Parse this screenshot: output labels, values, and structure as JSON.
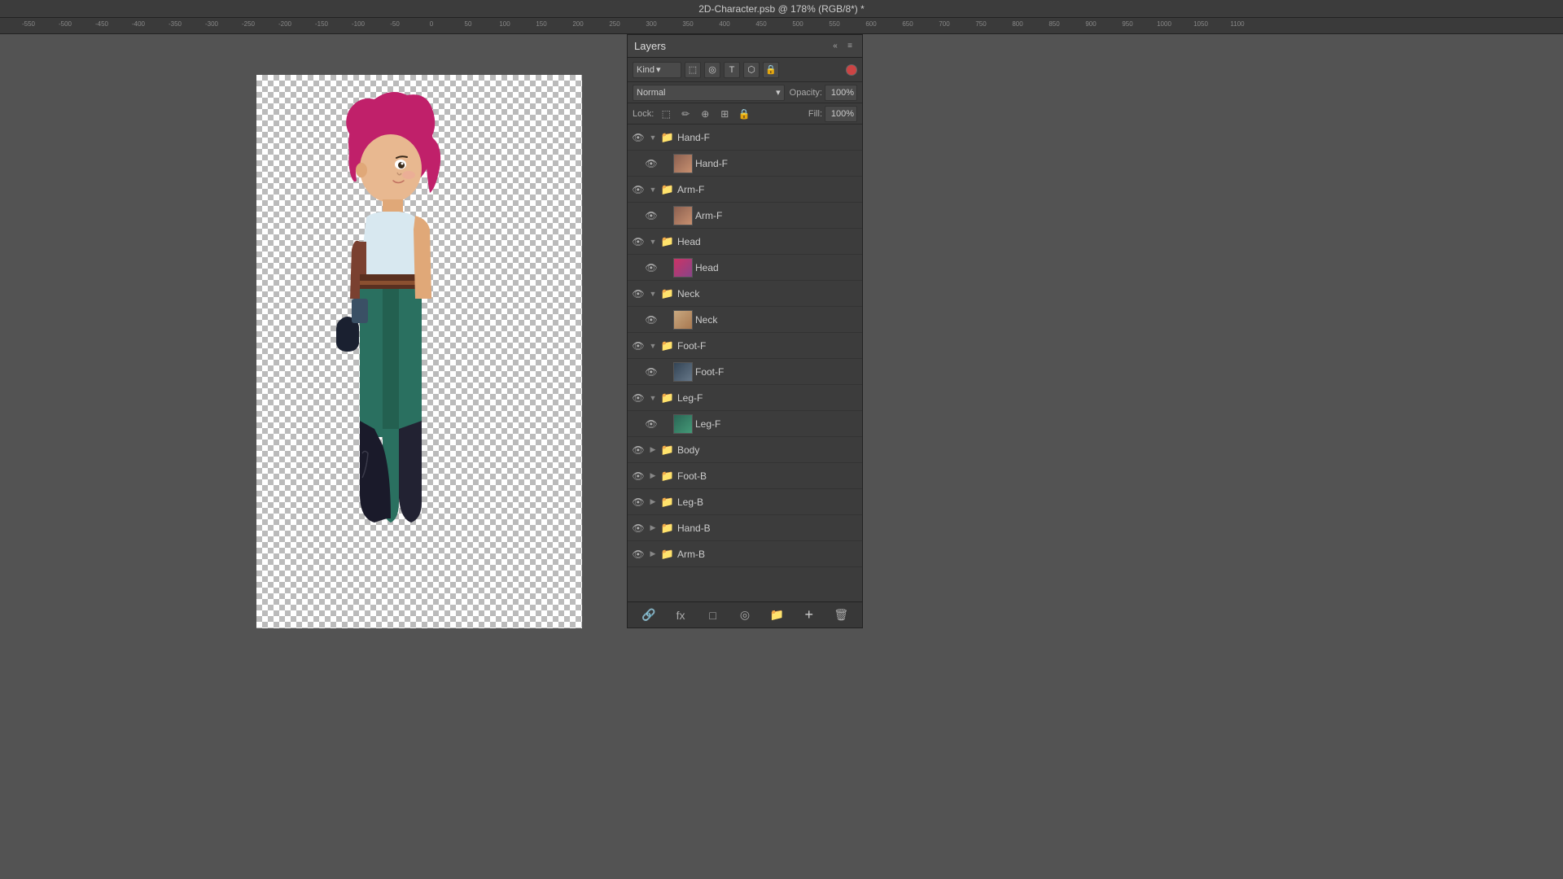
{
  "titlebar": {
    "title": "2D-Character.psb @ 178% (RGB/8*) *"
  },
  "layers_panel": {
    "title": "Layers",
    "close_icon": "×",
    "collapse_icon": "«",
    "filter": {
      "kind_label": "Kind",
      "dropdown_arrow": "▾"
    },
    "blend_mode": {
      "value": "Normal",
      "dropdown_arrow": "▾"
    },
    "opacity": {
      "label": "Opacity:",
      "value": "100%"
    },
    "lock": {
      "label": "Lock:",
      "icons": [
        "⬚",
        "✏",
        "⊕",
        "🔒",
        "🔒"
      ]
    },
    "fill": {
      "label": "Fill:",
      "value": "100%"
    },
    "layers": [
      {
        "id": 1,
        "name": "Hand-F",
        "type": "group",
        "visible": true,
        "expanded": true,
        "indent": 0,
        "selected": false
      },
      {
        "id": 2,
        "name": "Hand-F",
        "type": "layer",
        "visible": true,
        "expanded": false,
        "indent": 1,
        "selected": false
      },
      {
        "id": 3,
        "name": "Arm-F",
        "type": "group",
        "visible": true,
        "expanded": true,
        "indent": 0,
        "selected": false
      },
      {
        "id": 4,
        "name": "Arm-F",
        "type": "layer",
        "visible": true,
        "expanded": false,
        "indent": 1,
        "selected": false
      },
      {
        "id": 5,
        "name": "Head",
        "type": "group",
        "visible": true,
        "expanded": true,
        "indent": 0,
        "selected": false
      },
      {
        "id": 6,
        "name": "Head",
        "type": "layer",
        "visible": true,
        "expanded": false,
        "indent": 1,
        "selected": false
      },
      {
        "id": 7,
        "name": "Neck",
        "type": "group",
        "visible": true,
        "expanded": true,
        "indent": 0,
        "selected": false
      },
      {
        "id": 8,
        "name": "Neck",
        "type": "layer",
        "visible": true,
        "expanded": false,
        "indent": 1,
        "selected": false
      },
      {
        "id": 9,
        "name": "Foot-F",
        "type": "group",
        "visible": true,
        "expanded": true,
        "indent": 0,
        "selected": false
      },
      {
        "id": 10,
        "name": "Foot-F",
        "type": "layer",
        "visible": true,
        "expanded": false,
        "indent": 1,
        "selected": false
      },
      {
        "id": 11,
        "name": "Leg-F",
        "type": "group",
        "visible": true,
        "expanded": true,
        "indent": 0,
        "selected": false
      },
      {
        "id": 12,
        "name": "Leg-F",
        "type": "layer",
        "visible": true,
        "expanded": false,
        "indent": 1,
        "selected": false
      },
      {
        "id": 13,
        "name": "Body",
        "type": "group",
        "visible": true,
        "expanded": false,
        "indent": 0,
        "selected": false
      },
      {
        "id": 14,
        "name": "Foot-B",
        "type": "group",
        "visible": true,
        "expanded": false,
        "indent": 0,
        "selected": false
      },
      {
        "id": 15,
        "name": "Leg-B",
        "type": "group",
        "visible": true,
        "expanded": false,
        "indent": 0,
        "selected": false
      },
      {
        "id": 16,
        "name": "Hand-B",
        "type": "group",
        "visible": true,
        "expanded": false,
        "indent": 0,
        "selected": false
      },
      {
        "id": 17,
        "name": "Arm-B",
        "type": "group",
        "visible": true,
        "expanded": false,
        "indent": 0,
        "selected": false
      }
    ],
    "bottom_buttons": [
      "🔗",
      "fx",
      "□",
      "◎",
      "📁",
      "+",
      "🗑"
    ]
  },
  "ruler": {
    "marks": [
      "-550",
      "-500",
      "-450",
      "-400",
      "-350",
      "-300",
      "-250",
      "-200",
      "-150",
      "-100",
      "-50",
      "0",
      "50",
      "100",
      "150",
      "200",
      "250",
      "300",
      "350",
      "400",
      "450",
      "500",
      "550",
      "600",
      "650",
      "700",
      "750",
      "800",
      "850",
      "900",
      "950",
      "1000",
      "1050",
      "1100"
    ]
  }
}
